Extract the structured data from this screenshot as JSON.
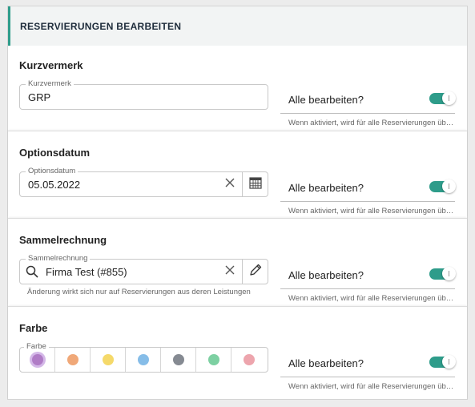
{
  "panel": {
    "title": "RESERVIERUNGEN BEARBEITEN"
  },
  "edit_all": {
    "label": "Alle bearbeiten?",
    "help": "Wenn aktiviert, wird für alle Reservierungen übernommen",
    "accent": "#2e9c8a"
  },
  "kurzvermerk": {
    "heading": "Kurzvermerk",
    "legend": "Kurzvermerk",
    "value": "GRP",
    "toggle_on": true
  },
  "optionsdatum": {
    "heading": "Optionsdatum",
    "legend": "Optionsdatum",
    "value": "05.05.2022",
    "icons": [
      "close-icon",
      "calendar-icon"
    ],
    "toggle_on": true
  },
  "sammelrechnung": {
    "heading": "Sammelrechnung",
    "legend": "Sammelrechnung",
    "value": "Firma Test (#855)",
    "helper": "Änderung wirkt sich nur auf Reservierungen aus deren Leistungen",
    "icons": [
      "search-icon",
      "close-icon",
      "pencil-icon"
    ],
    "toggle_on": true
  },
  "farbe": {
    "heading": "Farbe",
    "legend": "Farbe",
    "colors": [
      "#b07cc6",
      "#f0a878",
      "#f5d96a",
      "#86bde8",
      "#858a92",
      "#7dd0a2",
      "#eda5ad"
    ],
    "selected_index": 0,
    "toggle_on": true
  }
}
